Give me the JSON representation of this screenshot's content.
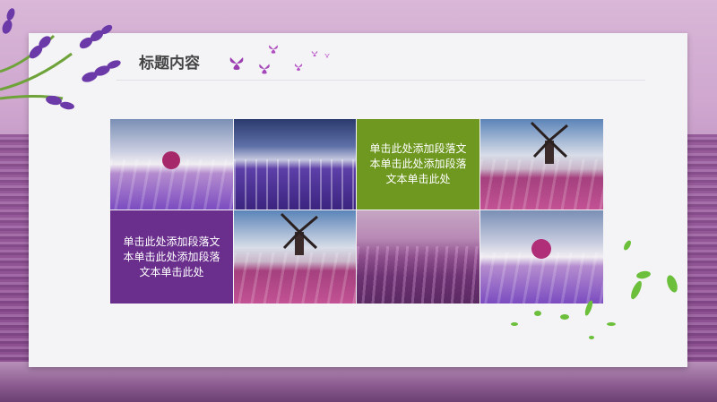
{
  "slide": {
    "title": "标题内容"
  },
  "text_blocks": {
    "green": "单击此处添加段落文本单击此处添加段落文本单击此处",
    "purple": "单击此处添加段落文本单击此处添加段落文本单击此处"
  },
  "images": [
    "lavender-field-tree",
    "lavender-rows-sky",
    "windmill-field",
    "windmill-field-2",
    "lavender-rows-sunset",
    "lavender-field-tree-2"
  ],
  "colors": {
    "accent_green": "#6f9820",
    "accent_purple": "#6a2f8c",
    "card_bg": "#f4f3f6",
    "title_text": "#444444"
  }
}
